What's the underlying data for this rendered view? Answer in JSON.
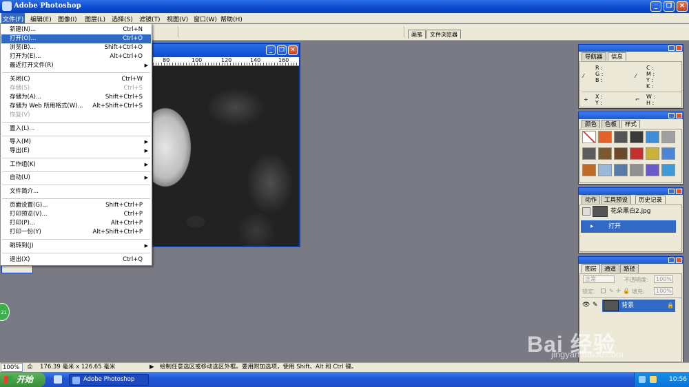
{
  "window": {
    "title": "Adobe Photoshop"
  },
  "menubar": {
    "items": [
      "文件(F)",
      "编辑(E)",
      "图像(I)",
      "图层(L)",
      "选择(S)",
      "滤镜(T)",
      "视图(V)",
      "窗口(W)",
      "帮助(H)"
    ]
  },
  "options_bar": {
    "tabs": [
      "画笔",
      "文件浏览器"
    ]
  },
  "document": {
    "ruler_ticks": [
      "80",
      "100",
      "120",
      "140",
      "160"
    ]
  },
  "file_menu": {
    "items": [
      {
        "label": "新建(N)...",
        "shortcut": "Ctrl+N",
        "state": "normal"
      },
      {
        "label": "打开(O)...",
        "shortcut": "Ctrl+O",
        "state": "highlighted"
      },
      {
        "label": "浏览(B)...",
        "shortcut": "Shift+Ctrl+O",
        "state": "normal"
      },
      {
        "label": "打开为(E)...",
        "shortcut": "Alt+Ctrl+O",
        "state": "normal"
      },
      {
        "label": "最近打开文件(R)",
        "shortcut": "",
        "state": "submenu"
      },
      {
        "label": "关闭(C)",
        "shortcut": "Ctrl+W",
        "state": "normal"
      },
      {
        "label": "存储(S)",
        "shortcut": "Ctrl+S",
        "state": "disabled"
      },
      {
        "label": "存储为(A)...",
        "shortcut": "Shift+Ctrl+S",
        "state": "normal"
      },
      {
        "label": "存储为 Web 所用格式(W)...",
        "shortcut": "Alt+Shift+Ctrl+S",
        "state": "normal"
      },
      {
        "label": "恢复(V)",
        "shortcut": "",
        "state": "disabled"
      },
      {
        "label": "置入(L)...",
        "shortcut": "",
        "state": "normal"
      },
      {
        "label": "导入(M)",
        "shortcut": "",
        "state": "submenu"
      },
      {
        "label": "导出(E)",
        "shortcut": "",
        "state": "submenu"
      },
      {
        "label": "工作组(K)",
        "shortcut": "",
        "state": "submenu"
      },
      {
        "label": "自动(U)",
        "shortcut": "",
        "state": "submenu"
      },
      {
        "label": "文件简介...",
        "shortcut": "",
        "state": "normal"
      },
      {
        "label": "页面设置(G)...",
        "shortcut": "Shift+Ctrl+P",
        "state": "normal"
      },
      {
        "label": "打印预览(V)...",
        "shortcut": "Ctrl+P",
        "state": "normal"
      },
      {
        "label": "打印(P)...",
        "shortcut": "Alt+Ctrl+P",
        "state": "normal"
      },
      {
        "label": "打印一份(Y)",
        "shortcut": "Alt+Shift+Ctrl+P",
        "state": "normal"
      },
      {
        "label": "跳转到(J)",
        "shortcut": "",
        "state": "submenu"
      },
      {
        "label": "退出(X)",
        "shortcut": "Ctrl+Q",
        "state": "normal"
      }
    ]
  },
  "navigator_panel": {
    "tabs": [
      "导航器",
      "信息"
    ],
    "rgb_labels": [
      "R :",
      "G :",
      "B :"
    ],
    "cmyk_labels": [
      "C :",
      "M :",
      "Y :",
      "K :"
    ],
    "xy_labels": [
      "X :",
      "Y :"
    ],
    "wh_labels": [
      "W :",
      "H :"
    ]
  },
  "swatches_panel": {
    "tabs": [
      "颜色",
      "色板",
      "样式"
    ],
    "colors": [
      "#ffffff",
      "#e2622a",
      "#555555",
      "#3a3a3a",
      "#3e8fd8",
      "#a0a0a0",
      "#5c5c5c",
      "#7a5a30",
      "#6b4a2a",
      "#c23030",
      "#c8b23a",
      "#4a86d8",
      "#c06a2a",
      "#9ab8d8",
      "#5a7aaa",
      "#909090",
      "#6a5ac8",
      "#3e9bd8"
    ]
  },
  "history_panel": {
    "tabs": [
      "动作",
      "工具预设",
      "历史记录"
    ],
    "snapshot": "花朵黑白2.jpg",
    "steps": [
      "打开"
    ]
  },
  "layers_panel": {
    "tabs": [
      "图层",
      "通道",
      "路径"
    ],
    "blend_mode": "正常",
    "opacity_label": "不透明度:",
    "opacity_value": "100%",
    "lock_label": "锁定:",
    "fill_label": "填充:",
    "fill_value": "100%",
    "layers": [
      "背景"
    ]
  },
  "status_bar": {
    "zoom": "100%",
    "doc_size": "176.39 毫米 x 126.65 毫米",
    "hint": "绘制任意选区或移动选区外框。要用附加选项，使用 Shift、Alt 和 Ctrl 键。"
  },
  "taskbar": {
    "start": "开始",
    "task": "Adobe Photoshop",
    "clock": "10:56"
  },
  "watermark": {
    "brand": "Bai 经验",
    "url": "jingyan.baidu.com"
  }
}
